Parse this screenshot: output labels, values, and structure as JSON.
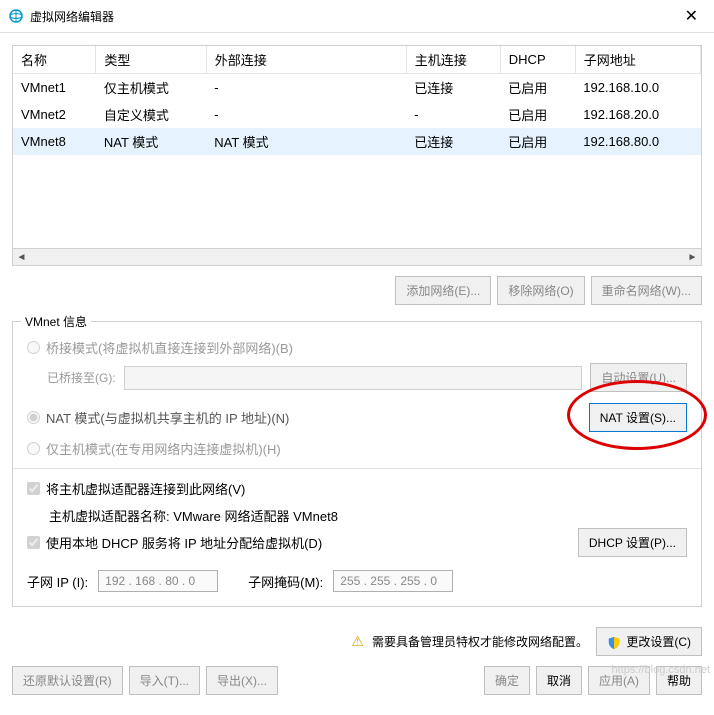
{
  "title": "虚拟网络编辑器",
  "table": {
    "headers": [
      "名称",
      "类型",
      "外部连接",
      "主机连接",
      "DHCP",
      "子网地址"
    ],
    "rows": [
      {
        "name": "VMnet1",
        "type": "仅主机模式",
        "ext": "-",
        "host": "已连接",
        "dhcp": "已启用",
        "subnet": "192.168.10.0"
      },
      {
        "name": "VMnet2",
        "type": "自定义模式",
        "ext": "-",
        "host": "-",
        "dhcp": "已启用",
        "subnet": "192.168.20.0"
      },
      {
        "name": "VMnet8",
        "type": "NAT 模式",
        "ext": "NAT 模式",
        "host": "已连接",
        "dhcp": "已启用",
        "subnet": "192.168.80.0"
      }
    ]
  },
  "buttons": {
    "add_network": "添加网络(E)...",
    "remove_network": "移除网络(O)",
    "rename_network": "重命名网络(W)...",
    "auto_settings": "自动设置(U)...",
    "nat_settings": "NAT 设置(S)...",
    "dhcp_settings": "DHCP 设置(P)...",
    "change_settings": "更改设置(C)",
    "restore_defaults": "还原默认设置(R)",
    "import": "导入(T)...",
    "export": "导出(X)...",
    "ok": "确定",
    "cancel": "取消",
    "apply": "应用(A)",
    "help": "帮助"
  },
  "vmnet_info": {
    "legend": "VMnet 信息",
    "bridge_radio": "桥接模式(将虚拟机直接连接到外部网络)(B)",
    "bridge_to": "已桥接至(G):",
    "nat_radio": "NAT 模式(与虚拟机共享主机的 IP 地址)(N)",
    "hostonly_radio": "仅主机模式(在专用网络内连接虚拟机)(H)",
    "connect_adapter": "将主机虚拟适配器连接到此网络(V)",
    "adapter_name": "主机虚拟适配器名称: VMware 网络适配器 VMnet8",
    "use_dhcp": "使用本地 DHCP 服务将 IP 地址分配给虚拟机(D)",
    "subnet_ip_label": "子网 IP (I):",
    "subnet_ip": "192 . 168 . 80 . 0",
    "subnet_mask_label": "子网掩码(M):",
    "subnet_mask": "255 . 255 . 255 . 0"
  },
  "admin_warning": "需要具备管理员特权才能修改网络配置。",
  "watermark": "https://blog.csdn.net"
}
